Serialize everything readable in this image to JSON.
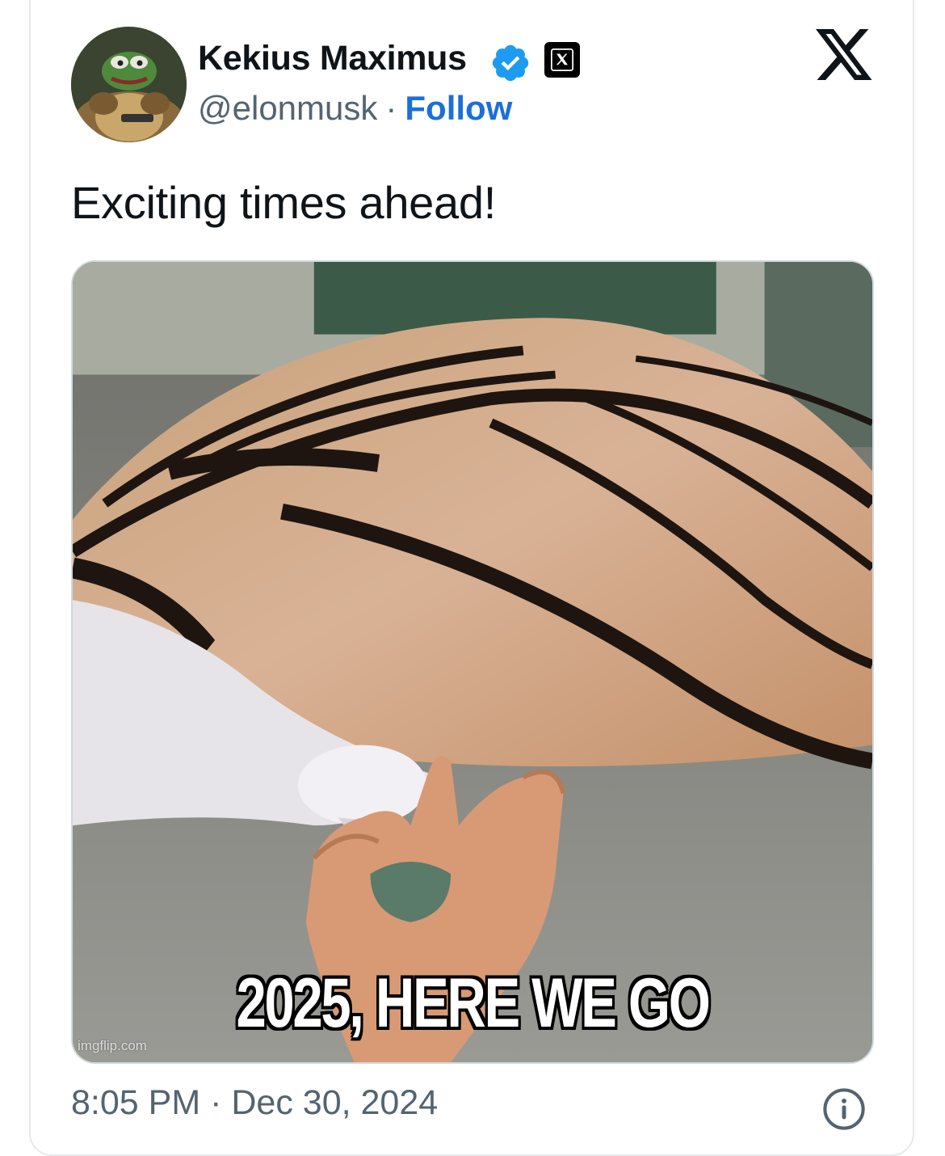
{
  "tweet": {
    "author_name": "Kekius Maximus",
    "handle": "@elonmusk",
    "separator": "·",
    "follow_label": "Follow",
    "text": "Exciting times ahead!",
    "media": {
      "caption": "2025, HERE WE GO",
      "watermark": "imgflip.com"
    },
    "time": "8:05 PM",
    "time_separator": "·",
    "date": "Dec 30, 2024"
  },
  "icons": {
    "verified": "verified-badge-icon",
    "affiliate": "x-affiliate-icon",
    "platform": "x-logo-icon",
    "info": "info-icon"
  },
  "colors": {
    "follow": "#1d6fd8",
    "verified": "#1d9bf0",
    "text": "#0f1419",
    "secondary": "#536471"
  }
}
